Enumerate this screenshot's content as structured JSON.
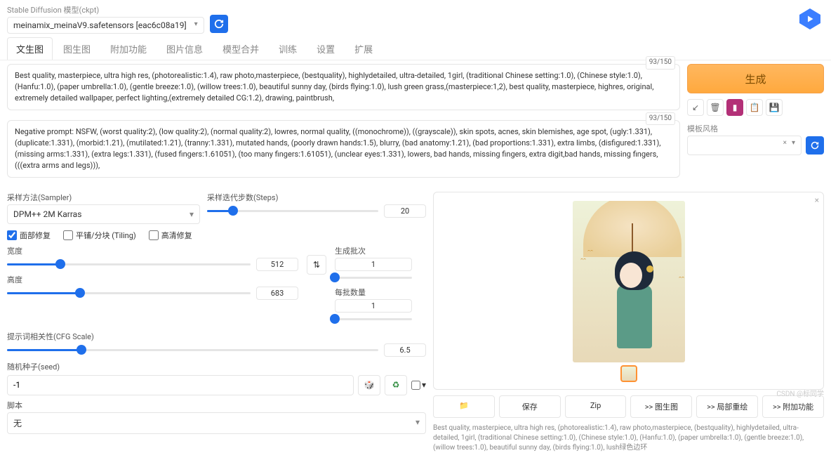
{
  "header": {
    "model_label": "Stable Diffusion 模型(ckpt)",
    "model_value": "meinamix_meinaV9.safetensors [eac6c08a19]"
  },
  "tabs": [
    "文生图",
    "图生图",
    "附加功能",
    "图片信息",
    "模型合并",
    "训练",
    "设置",
    "扩展"
  ],
  "active_tab": 0,
  "prompt": {
    "counter": "93/150",
    "text": "Best quality, masterpiece, ultra high res, (photorealistic:1.4), raw photo,masterpiece, (bestquality), highlydetailed, ultra-detailed, 1girl, (traditional Chinese setting:1.0), (Chinese style:1.0), (Hanfu:1.0), (paper umbrella:1.0), (gentle breeze:1.0), (willow trees:1.0), beautiful sunny day, (birds flying:1.0), lush green grass,(masterpiece:1,2), best quality, masterpiece, highres, original, extremely detailed wallpaper, perfect lighting,(extremely detailed CG:1.2), drawing, paintbrush,"
  },
  "neg_prompt": {
    "counter": "93/150",
    "text": "Negative prompt: NSFW, (worst quality:2), (low quality:2), (normal quality:2), lowres, normal quality, ((monochrome)), ((grayscale)), skin spots, acnes, skin blemishes, age spot, (ugly:1.331), (duplicate:1.331), (morbid:1.21), (mutilated:1.21), (tranny:1.331), mutated hands, (poorly drawn hands:1.5), blurry, (bad anatomy:1.21), (bad proportions:1.331), extra limbs, (disfigured:1.331), (missing arms:1.331), (extra legs:1.331), (fused fingers:1.61051), (too many fingers:1.61051), (unclear eyes:1.331), lowers, bad hands, missing fingers, extra digit,bad hands, missing fingers, (((extra arms and legs))),"
  },
  "generate_label": "生成",
  "style_label": "模板风格",
  "style_clear": "×",
  "sampler": {
    "method_label": "采样方法(Sampler)",
    "method_value": "DPM++ 2M Karras",
    "steps_label": "采样迭代步数(Steps)",
    "steps_value": "20",
    "steps_pct": 15
  },
  "checks": {
    "face": "面部修复",
    "tiling": "平铺/分块 (Tiling)",
    "hires": "高清修复"
  },
  "dims": {
    "width_label": "宽度",
    "width_value": "512",
    "width_pct": 22,
    "height_label": "高度",
    "height_value": "683",
    "height_pct": 30,
    "batch_count_label": "生成批次",
    "batch_count_value": "1",
    "batch_count_pct": 0,
    "batch_size_label": "每批数量",
    "batch_size_value": "1",
    "batch_size_pct": 0
  },
  "cfg": {
    "label": "提示词相关性(CFG Scale)",
    "value": "6.5",
    "pct": 20
  },
  "seed": {
    "label": "随机种子(seed)",
    "value": "-1"
  },
  "script": {
    "label": "脚本",
    "value": "无"
  },
  "result": {
    "buttons": {
      "folder": "📁",
      "save": "保存",
      "zip": "Zip",
      "img2img": ">> 图生图",
      "inpaint": ">> 局部重绘",
      "extras": ">> 附加功能"
    },
    "prompt_echo": "Best quality, masterpiece, ultra high res, (photorealistic:1.4), raw photo,masterpiece, (bestquality), highlydetailed, ultra-detailed, 1girl, (traditional Chinese setting:1.0), (Chinese style:1.0), (Hanfu:1.0), (paper umbrella:1.0), (gentle breeze:1.0), (willow trees:1.0), beautiful sunny day, (birds flying:1.0), lush绿色边环"
  },
  "watermark": "CSDN @标同学"
}
